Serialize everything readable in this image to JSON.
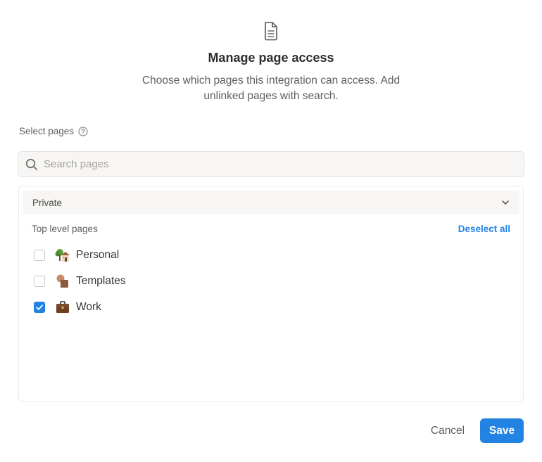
{
  "dialog": {
    "icon": "document-icon",
    "title": "Manage page access",
    "subtitle": "Choose which pages this integration can access. Add unlinked pages with search."
  },
  "select_pages": {
    "label": "Select pages",
    "help_icon": "question-circle-icon"
  },
  "search": {
    "placeholder": "Search pages",
    "value": ""
  },
  "section": {
    "label": "Private",
    "expanded": true,
    "list_label": "Top level pages",
    "deselect_all": "Deselect all",
    "pages": [
      {
        "title": "Personal",
        "icon": "house-with-tree-emoji",
        "checked": false
      },
      {
        "title": "Templates",
        "icon": "stacked-shapes-emoji",
        "checked": false
      },
      {
        "title": "Work",
        "icon": "briefcase-emoji",
        "checked": true
      }
    ]
  },
  "footer": {
    "cancel": "Cancel",
    "save": "Save"
  },
  "colors": {
    "accent": "#2383e2",
    "text": "#37352f",
    "muted": "#5f5e5b",
    "header_bg": "#f7f6f4"
  }
}
